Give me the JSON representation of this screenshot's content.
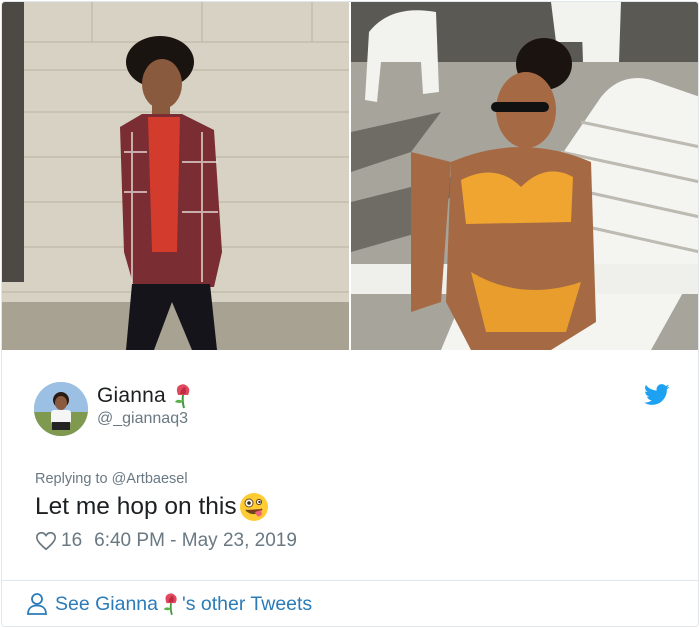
{
  "tweet": {
    "display_name": "Gianna",
    "handle": "@_giannaq3",
    "reply_to": "Replying to @Artbaesel",
    "text": "Let me hop on this",
    "likes": "16",
    "timestamp": "6:40 PM - May 23, 2019"
  },
  "footer": {
    "see_prefix": "See Gianna",
    "see_suffix": "'s other Tweets"
  },
  "icons": {
    "brand": "twitter-bird-icon",
    "name_emoji": "rose-icon",
    "text_emoji": "zany-face-icon",
    "like": "heart-icon",
    "profile": "person-icon"
  },
  "colors": {
    "link": "#2b7bb9",
    "muted": "#697882",
    "text": "#1c2022",
    "twitter_blue": "#1da1f2",
    "border": "#e1e8ed"
  }
}
